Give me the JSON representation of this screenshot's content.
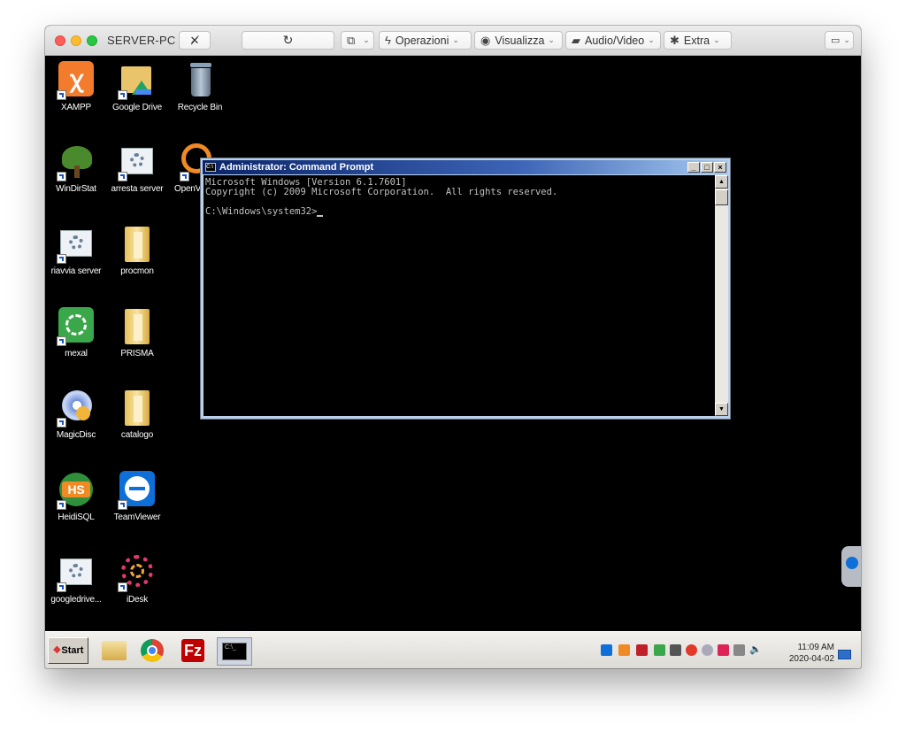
{
  "window": {
    "title": "SERVER-PC",
    "toolbar": {
      "operazioni": "Operazioni",
      "visualizza": "Visualizza",
      "audio_video": "Audio/Video",
      "extra": "Extra"
    }
  },
  "desktop": {
    "icons": [
      {
        "label": "XAMPP",
        "icon": "xampp-icon"
      },
      {
        "label": "Google Drive",
        "icon": "google-drive-icon"
      },
      {
        "label": "Recycle Bin",
        "icon": "recycle-bin-icon"
      },
      {
        "label": "WinDirStat",
        "icon": "windirstat-icon"
      },
      {
        "label": "arresta server",
        "icon": "settings-shortcut-icon"
      },
      {
        "label": "OpenV",
        "icon": "openvpn-icon"
      },
      {
        "label": "riavvia server",
        "icon": "settings-shortcut-icon"
      },
      {
        "label": "procmon",
        "icon": "folder-icon"
      },
      {
        "label": "mexal",
        "icon": "mexal-icon"
      },
      {
        "label": "PRISMA",
        "icon": "folder-icon"
      },
      {
        "label": "MagicDisc",
        "icon": "magicdisc-icon"
      },
      {
        "label": "catalogo",
        "icon": "folder-icon"
      },
      {
        "label": "HeidiSQL",
        "icon": "heidisql-icon"
      },
      {
        "label": "TeamViewer",
        "icon": "teamviewer-icon"
      },
      {
        "label": "googledrive...",
        "icon": "settings-shortcut-icon"
      },
      {
        "label": "iDesk",
        "icon": "idesk-icon"
      }
    ]
  },
  "cmd": {
    "title": "Administrator: Command Prompt",
    "line1": "Microsoft Windows [Version 6.1.7601]",
    "line2": "Copyright (c) 2009 Microsoft Corporation.  All rights reserved.",
    "prompt": "C:\\Windows\\system32>"
  },
  "taskbar": {
    "start": "Start",
    "apps": [
      "explorer-icon",
      "chrome-icon",
      "filezilla-icon",
      "cmd-icon"
    ],
    "time": "11:09 AM",
    "date": "2020-04-02"
  },
  "colors": {
    "desktop": "#000000",
    "titlebar_start": "#0a246a",
    "titlebar_end": "#a6caf0"
  }
}
